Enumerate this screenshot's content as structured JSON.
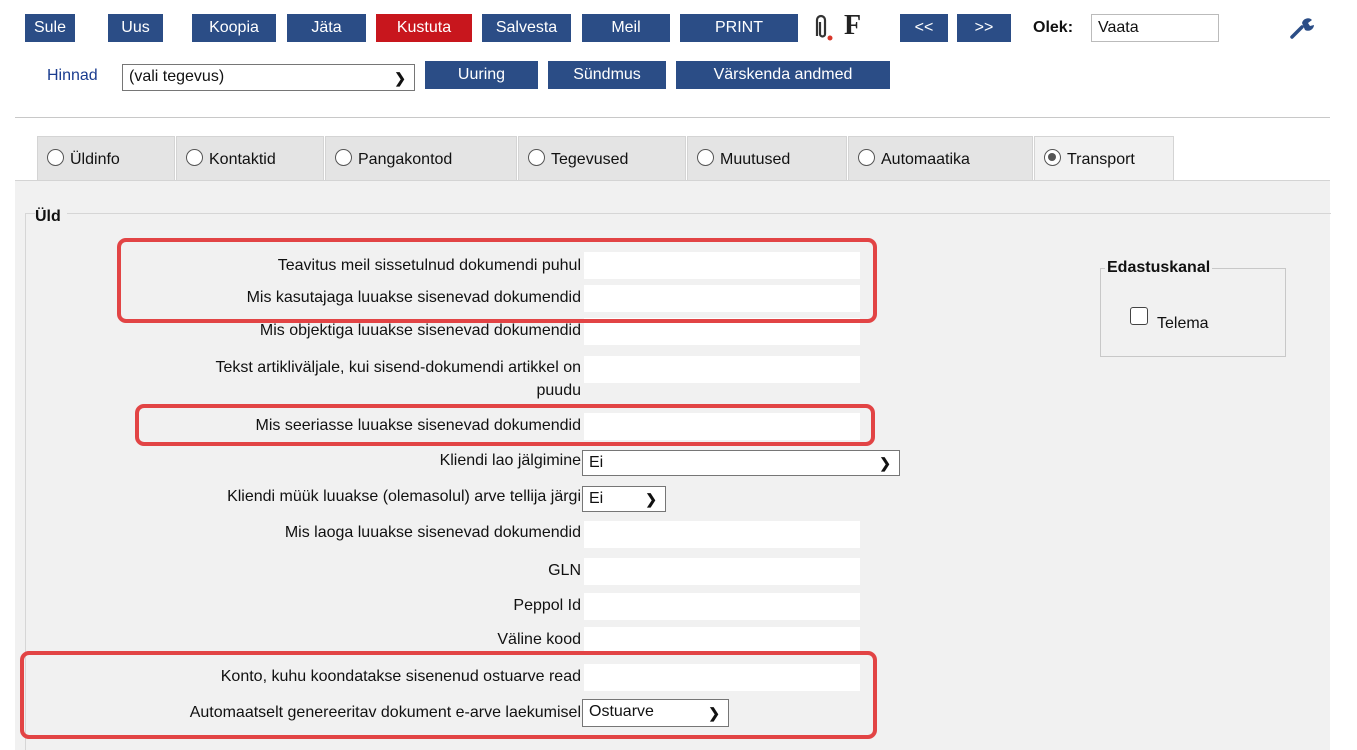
{
  "toolbar": {
    "sule": "Sule",
    "uus": "Uus",
    "koopia": "Koopia",
    "jata": "Jäta",
    "kustuta": "Kustuta",
    "salvesta": "Salvesta",
    "meil": "Meil",
    "print": "PRINT",
    "f_label": "F",
    "prev": "<<",
    "next": ">>",
    "olek_label": "Olek:",
    "olek_value": "Vaata",
    "hinnad_link": "Hinnad",
    "tegevus_select": "(vali tegevus)",
    "uuring": "Uuring",
    "syndmus": "Sündmus",
    "varskenda": "Värskenda andmed"
  },
  "tabs": [
    {
      "label": "Üldinfo",
      "active": false
    },
    {
      "label": "Kontaktid",
      "active": false
    },
    {
      "label": "Pangakontod",
      "active": false
    },
    {
      "label": "Tegevused",
      "active": false
    },
    {
      "label": "Muutused",
      "active": false
    },
    {
      "label": "Automaatika",
      "active": false
    },
    {
      "label": "Transport",
      "active": true
    }
  ],
  "section": {
    "legend": "Üld",
    "fields": {
      "teavitus": {
        "label": "Teavitus meil sissetulnud dokumendi puhul",
        "value": ""
      },
      "kasutaja": {
        "label": "Mis kasutajaga luuakse sisenevad dokumendid",
        "value": ""
      },
      "objekt": {
        "label": "Mis objektiga luuakse sisenevad dokumendid",
        "value": ""
      },
      "tekst_l1": {
        "label": "Tekst artikliväljale, kui sisend-dokumendi artikkel on"
      },
      "tekst_l2": {
        "label": "puudu"
      },
      "tekst_value": "",
      "seeria": {
        "label": "Mis seeriasse luuakse sisenevad dokumendid",
        "value": ""
      },
      "ladu_jalg": {
        "label": "Kliendi lao jälgimine",
        "value": "Ei"
      },
      "myyk": {
        "label": "Kliendi müük luuakse (olemasolul) arve tellija järgi",
        "value": "Ei"
      },
      "laoga": {
        "label": "Mis laoga luuakse sisenevad dokumendid",
        "value": ""
      },
      "gln": {
        "label": "GLN",
        "value": ""
      },
      "peppol": {
        "label": "Peppol Id",
        "value": ""
      },
      "valine": {
        "label": "Väline kood",
        "value": ""
      },
      "konto": {
        "label": "Konto, kuhu koondatakse sisenenud ostuarve read",
        "value": ""
      },
      "auto_dok": {
        "label": "Automaatselt genereeritav dokument e-arve laekumisel",
        "value": "Ostuarve"
      }
    },
    "edastuskanal": {
      "title": "Edastuskanal",
      "telema_label": "Telema",
      "telema_checked": false
    }
  },
  "colors": {
    "button_blue": "#2b4d86",
    "button_red": "#c8161d",
    "highlight_red": "#e24445",
    "panel_bg": "#f1f1f1"
  }
}
